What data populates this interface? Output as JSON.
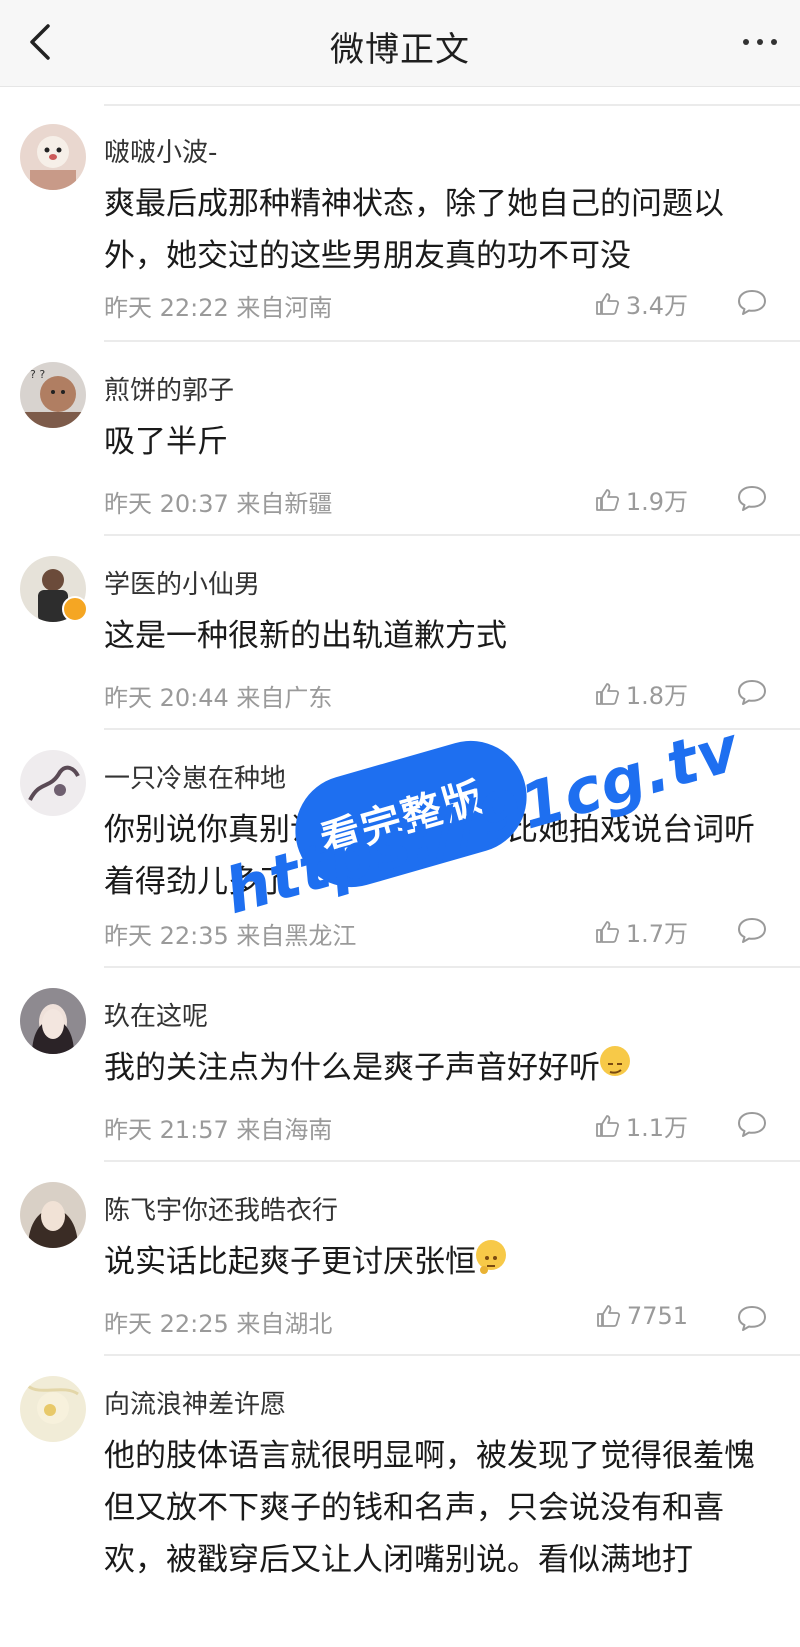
{
  "nav": {
    "back_icon": "chevron-left-icon",
    "title": "微博正文",
    "more_icon": "more-horizontal-icon"
  },
  "comments": [
    {
      "username": "啵啵小波-",
      "text": "爽最后成那种精神状态，除了她自己的问题以外，她交过的这些男朋友真的功不可没",
      "time": "昨天 22:22 来自河南",
      "likes": "3.4万",
      "verified": false
    },
    {
      "username": "煎饼的郭子",
      "text": "吸了半斤",
      "time": "昨天 20:37 来自新疆",
      "likes": "1.9万",
      "verified": false
    },
    {
      "username": "学医的小仙男",
      "text": "这是一种很新的出轨道歉方式",
      "time": "昨天 20:44 来自广东",
      "likes": "1.8万",
      "verified": true
    },
    {
      "username": "一只冷崽在种地",
      "text": "你别说你真别说，那段话说的比她拍戏说台词听着得劲儿多了",
      "time": "昨天 22:35 来自黑龙江",
      "likes": "1.7万",
      "verified": false
    },
    {
      "username": "玖在这呢",
      "text": "我的关注点为什么是爽子声音好好听",
      "time": "昨天 21:57 来自海南",
      "likes": "1.1万",
      "verified": false,
      "emoji": "smirk-emoji"
    },
    {
      "username": "陈飞宇你还我皓衣行",
      "text": "说实话比起爽子更讨厌张恒",
      "time": "昨天 22:25 来自湖北",
      "likes": "7751",
      "verified": false,
      "emoji": "thinking-emoji"
    },
    {
      "username": "向流浪神差许愿",
      "text": "他的肢体语言就很明显啊，被发现了觉得很羞愧但又放不下爽子的钱和名声，只会说没有和喜欢，被戳穿后又让人闭嘴别说。看似满地打",
      "time": "",
      "likes": "",
      "verified": false
    }
  ],
  "watermark": {
    "badge": "看完整版",
    "url": "https://91cg.tv"
  },
  "colors": {
    "accent_blue": "#1e6ff0",
    "meta_gray": "#9a9a9a",
    "verified_badge": "#f5a623"
  }
}
